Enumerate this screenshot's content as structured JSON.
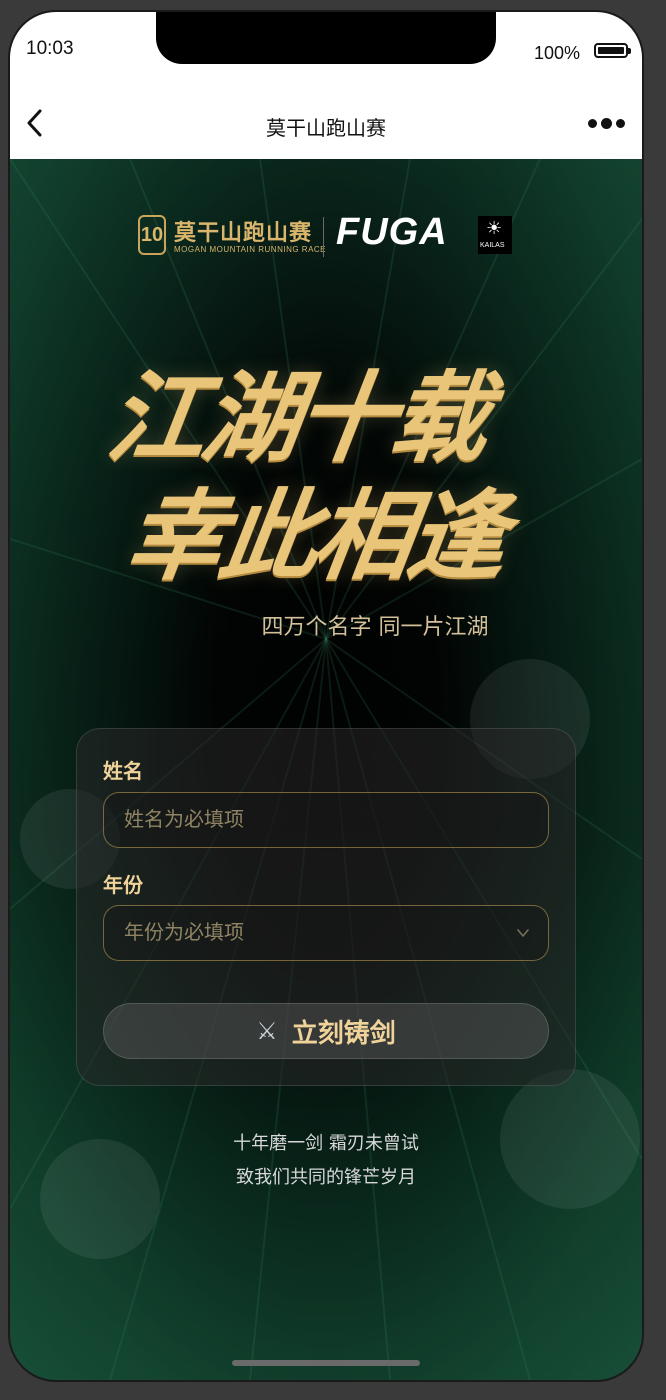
{
  "status": {
    "time": "10:03",
    "battery": "100%"
  },
  "nav": {
    "title": "莫干山跑山赛"
  },
  "logos": {
    "event_number": "10",
    "event_cn": "莫干山跑山赛",
    "event_en": "MOGAN MOUNTAIN RUNNING RACE",
    "sponsor": "FUGA",
    "sponsor_brand": "KAILAS"
  },
  "hero": {
    "headline_1": "江湖十载",
    "headline_2": "幸此相逢",
    "subtitle": "四万个名字 同一片江湖"
  },
  "form": {
    "name_label": "姓名",
    "name_placeholder": "姓名为必填项",
    "year_label": "年份",
    "year_placeholder": "年份为必填项",
    "submit_label": "立刻铸剑"
  },
  "footer": {
    "line_1": "十年磨一剑 霜刃未曾试",
    "line_2": "致我们共同的锋芒岁月"
  },
  "colors": {
    "accent_gold": "#f0d39a",
    "background": "#0d1a14"
  }
}
